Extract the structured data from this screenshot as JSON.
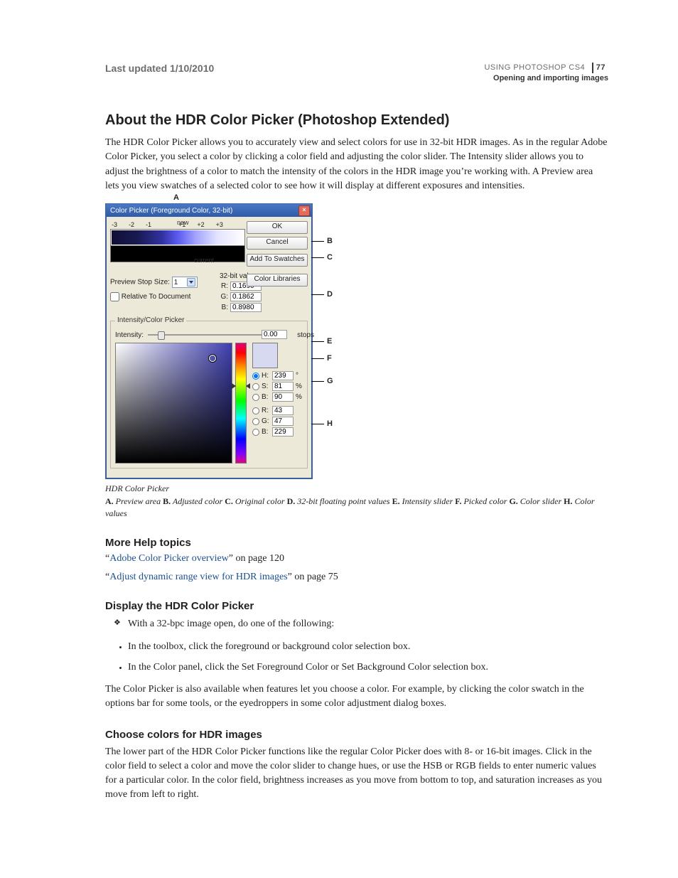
{
  "header": {
    "last_updated": "Last updated 1/10/2010",
    "doc_title": "USING PHOTOSHOP CS4",
    "chapter": "Opening and importing images",
    "page_number": "77"
  },
  "h1": "About the HDR Color Picker (Photoshop Extended)",
  "intro": "The HDR Color Picker allows you to accurately view and select colors for use in 32-bit HDR images. As in the regular Adobe Color Picker, you select a color by clicking a color field and adjusting the color slider. The Intensity slider allows you to adjust the brightness of a color to match the intensity of the colors in the HDR image you’re working with. A Preview area lets you view swatches of a selected color to see how it will display at different exposures and intensities.",
  "dialog": {
    "title": "Color Picker (Foreground Color, 32-bit)",
    "close": "×",
    "stops": [
      "-3",
      "-2",
      "-1",
      "",
      "+1",
      "+2",
      "+3"
    ],
    "label_new": "new",
    "label_current": "current",
    "preview_stop_size_label": "Preview Stop Size:",
    "preview_stop_size_value": "1",
    "relative_label": "Relative To Document",
    "buttons": {
      "ok": "OK",
      "cancel": "Cancel",
      "add_swatches": "Add To Swatches",
      "color_libraries": "Color Libraries"
    },
    "bit_header": "32-bit value",
    "bit": {
      "r_label": "R:",
      "g_label": "G:",
      "b_label": "B:",
      "r": "0.1690",
      "g": "0.1862",
      "b": "0.8980"
    },
    "group_title": "Intensity/Color Picker",
    "intensity_label": "Intensity:",
    "intensity_value": "0.00",
    "intensity_stops": "stops",
    "hsb": {
      "h_label": "H:",
      "h": "239",
      "h_unit": "°",
      "s_label": "S:",
      "s": "81",
      "s_unit": "%",
      "b_label": "B:",
      "b": "90",
      "b_unit": "%",
      "r_label": "R:",
      "r": "43",
      "g_label": "G:",
      "g": "47",
      "bb_label": "B:",
      "bb": "229"
    }
  },
  "callouts": {
    "A": "A",
    "B": "B",
    "C": "C",
    "D": "D",
    "E": "E",
    "F": "F",
    "G": "G",
    "H": "H"
  },
  "caption_title": "HDR Color Picker",
  "caption_legend_parts": {
    "A_k": "A.",
    "A_v": " Preview area  ",
    "B_k": "B.",
    "B_v": " Adjusted color  ",
    "C_k": "C.",
    "C_v": " Original color  ",
    "D_k": "D.",
    "D_v": " 32-bit floating point values  ",
    "E_k": "E.",
    "E_v": " Intensity slider  ",
    "F_k": "F.",
    "F_v": " Picked color  ",
    "G_k": "G.",
    "G_v": " Color slider  ",
    "H_k": "H.",
    "H_v": " Color values"
  },
  "more_help": {
    "heading": "More Help topics",
    "link1_text": "Adobe Color Picker overview",
    "link1_tail": "” on page 120",
    "link2_text": "Adjust dynamic range view for HDR images",
    "link2_tail": "” on page 75",
    "quote": "“"
  },
  "display": {
    "heading": "Display the HDR Color Picker",
    "intro_bullet": "With a 32-bpc image open, do one of the following:",
    "sub1": "In the toolbox, click the foreground or background color selection box.",
    "sub2": "In the Color panel, click the Set Foreground Color or Set Background Color selection box.",
    "after": "The Color Picker is also available when features let you choose a color. For example, by clicking the color swatch in the options bar for some tools, or the eyedroppers in some color adjustment dialog boxes."
  },
  "choose": {
    "heading": "Choose colors for HDR images",
    "body": "The lower part of the HDR Color Picker functions like the regular Color Picker does with 8- or 16-bit images. Click in the color field to select a color and move the color slider to change hues, or use the HSB or RGB fields to enter numeric values for a particular color. In the color field, brightness increases as you move from bottom to top, and saturation increases as you move from left to right."
  }
}
